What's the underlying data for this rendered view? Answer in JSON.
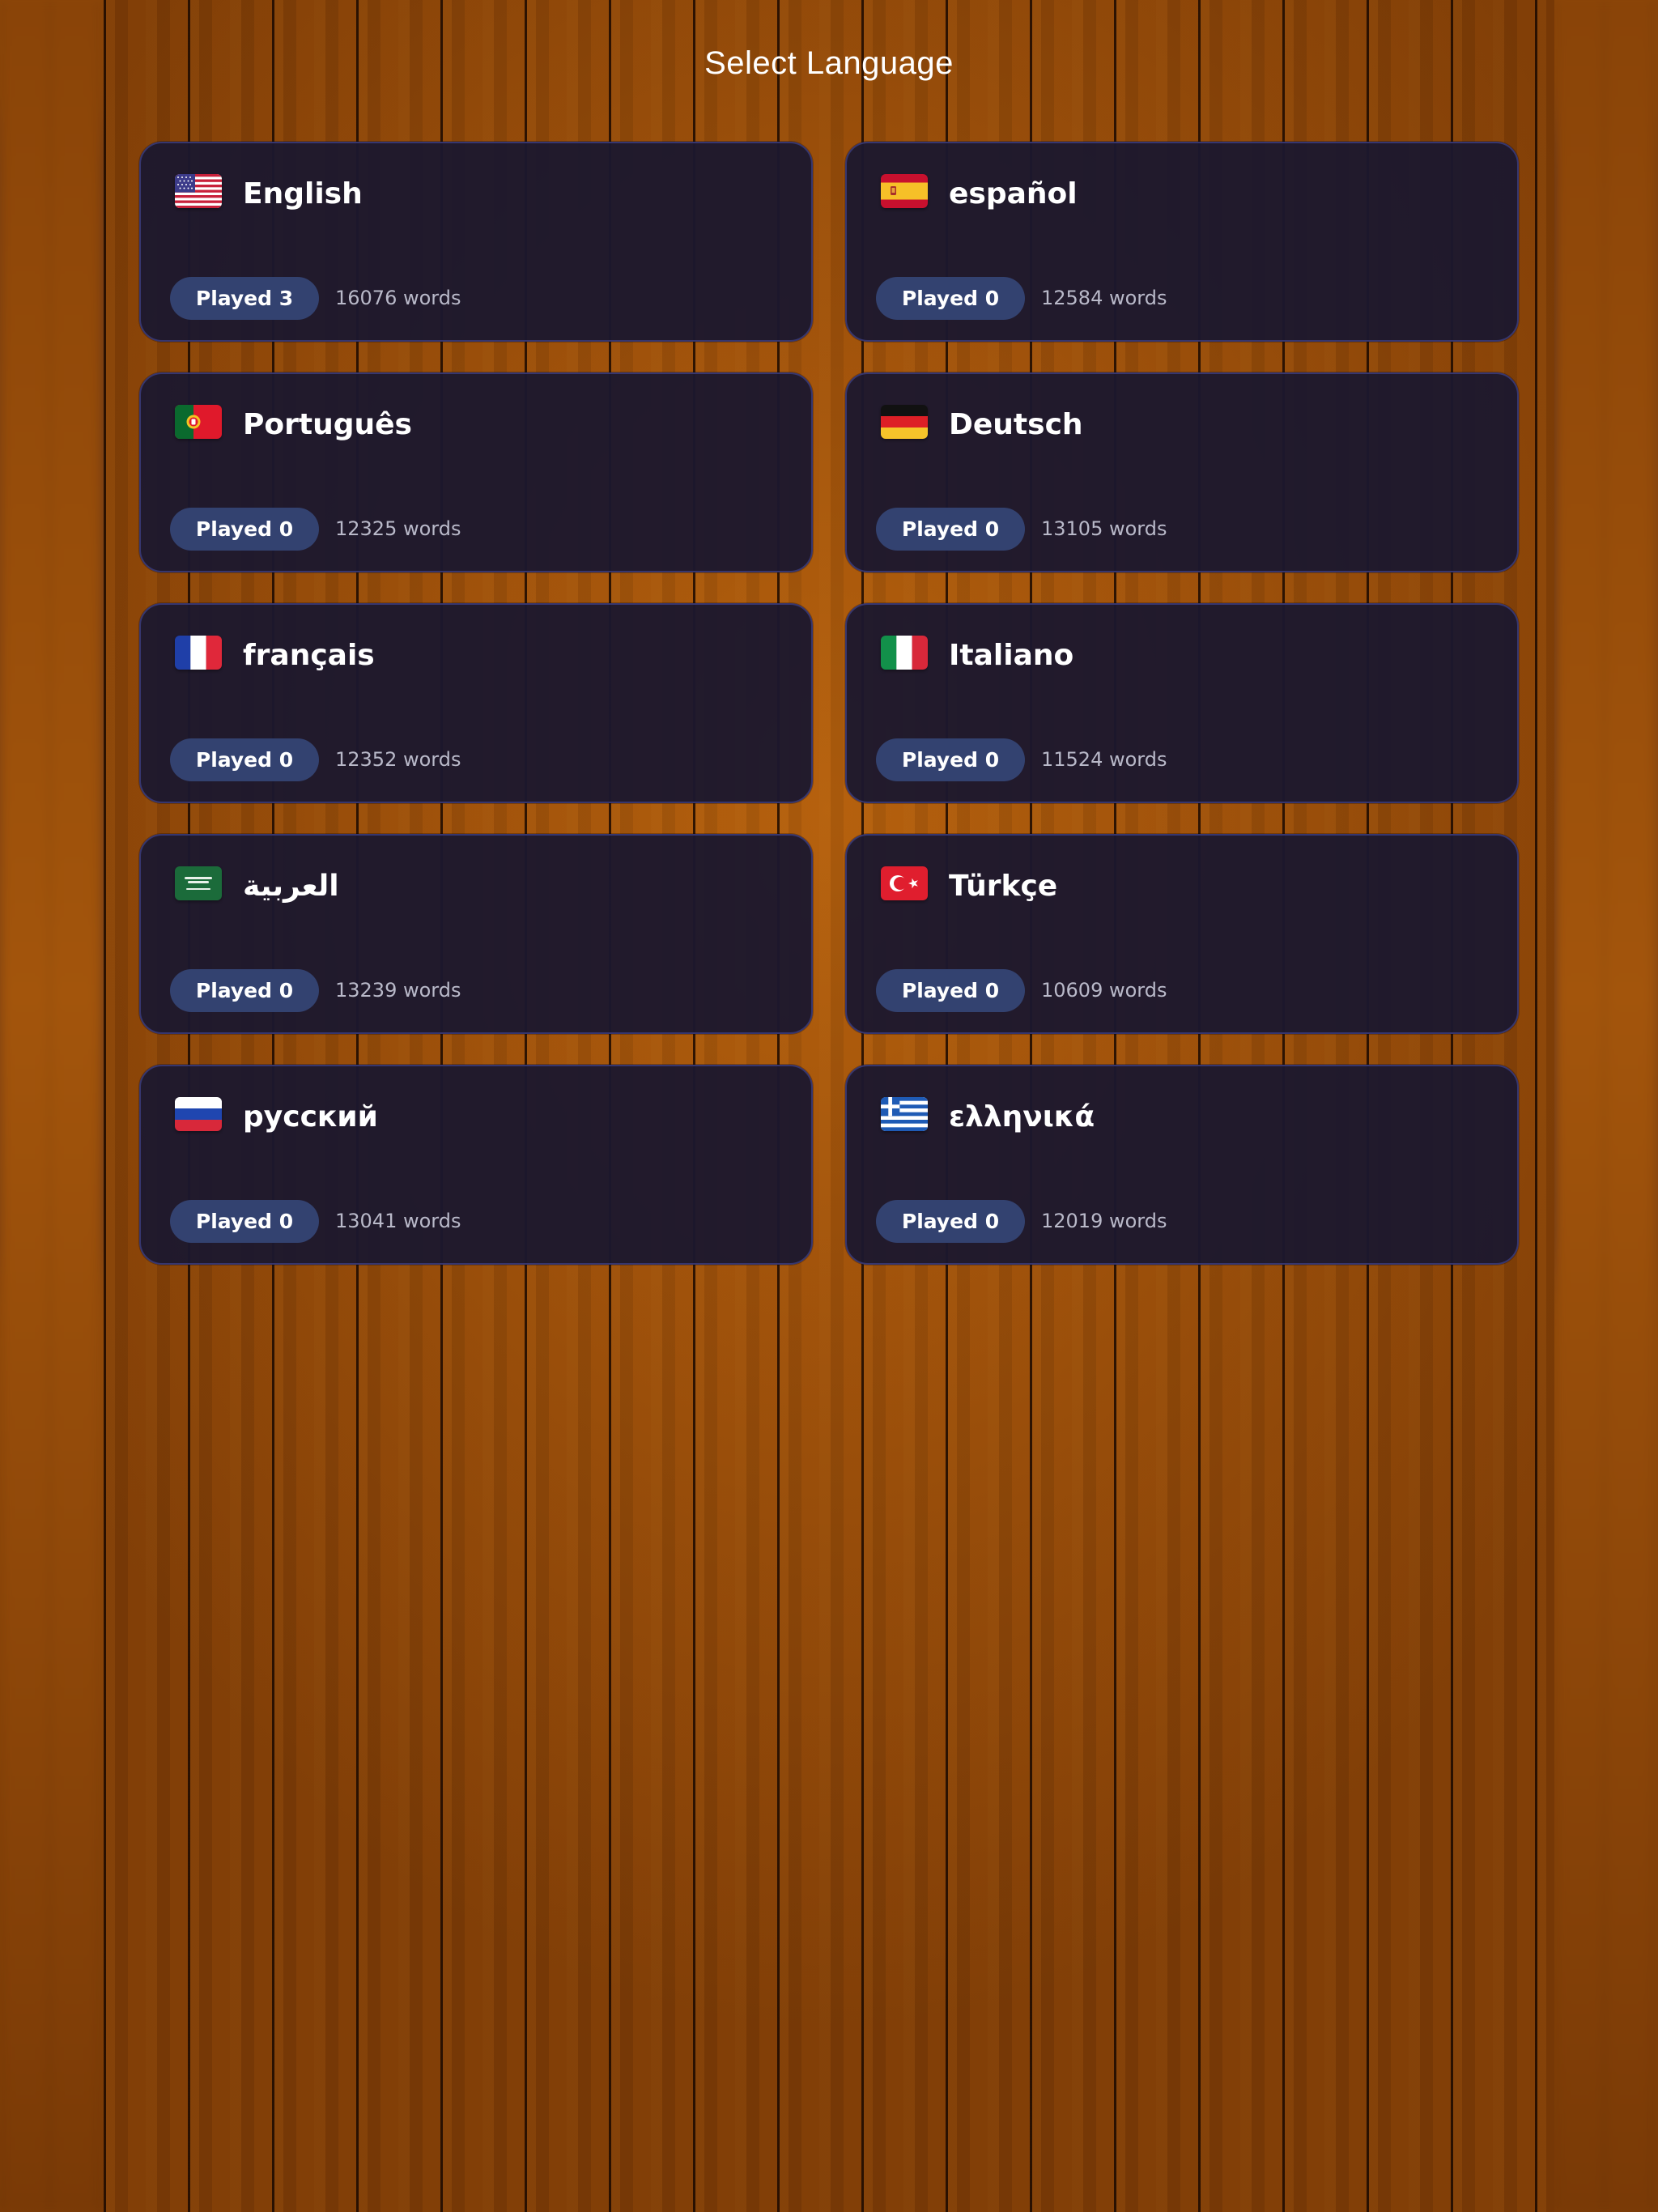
{
  "header": {
    "title": "Select Language"
  },
  "colors": {
    "card_background": "#1c182e",
    "card_border": "#36366f",
    "badge_background": "#334270",
    "word_count_text": "#b9b9c9",
    "wood": "#9b4f0a"
  },
  "languages": [
    {
      "name": "English",
      "flag_icon": "us-flag-icon",
      "played": "Played 3",
      "words": "16076 words"
    },
    {
      "name": "español",
      "flag_icon": "es-flag-icon",
      "played": "Played 0",
      "words": "12584 words"
    },
    {
      "name": "Português",
      "flag_icon": "pt-flag-icon",
      "played": "Played 0",
      "words": "12325 words"
    },
    {
      "name": "Deutsch",
      "flag_icon": "de-flag-icon",
      "played": "Played 0",
      "words": "13105 words"
    },
    {
      "name": "français",
      "flag_icon": "fr-flag-icon",
      "played": "Played 0",
      "words": "12352 words"
    },
    {
      "name": "Italiano",
      "flag_icon": "it-flag-icon",
      "played": "Played 0",
      "words": "11524 words"
    },
    {
      "name": "العربية",
      "flag_icon": "sa-flag-icon",
      "played": "Played 0",
      "words": "13239 words"
    },
    {
      "name": "Türkçe",
      "flag_icon": "tr-flag-icon",
      "played": "Played 0",
      "words": "10609 words"
    },
    {
      "name": "русский",
      "flag_icon": "ru-flag-icon",
      "played": "Played 0",
      "words": "13041 words"
    },
    {
      "name": "ελληνικά",
      "flag_icon": "gr-flag-icon",
      "played": "Played 0",
      "words": "12019 words"
    }
  ]
}
